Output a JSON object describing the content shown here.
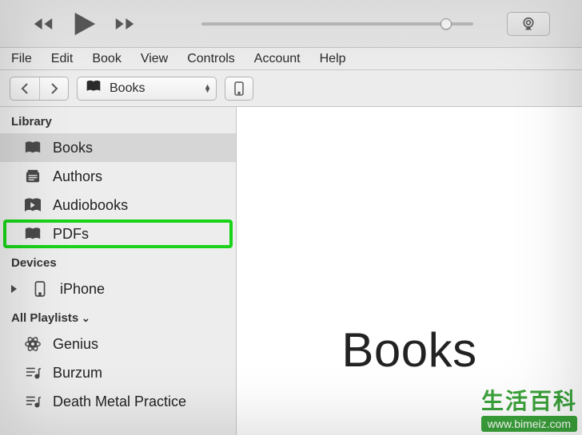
{
  "menu": {
    "items": [
      "File",
      "Edit",
      "Book",
      "View",
      "Controls",
      "Account",
      "Help"
    ]
  },
  "toolbar": {
    "media_selector": "Books"
  },
  "sidebar": {
    "library_label": "Library",
    "library_items": [
      {
        "id": "books",
        "label": "Books",
        "icon": "books-icon",
        "selected": true
      },
      {
        "id": "authors",
        "label": "Authors",
        "icon": "authors-icon"
      },
      {
        "id": "audiobooks",
        "label": "Audiobooks",
        "icon": "audiobook-icon"
      },
      {
        "id": "pdfs",
        "label": "PDFs",
        "icon": "books-icon",
        "highlight": true
      }
    ],
    "devices_label": "Devices",
    "devices": [
      {
        "id": "iphone",
        "label": "iPhone",
        "icon": "iphone-icon"
      }
    ],
    "playlists_label": "All Playlists",
    "playlists": [
      {
        "id": "genius",
        "label": "Genius",
        "icon": "genius-icon"
      },
      {
        "id": "burzum",
        "label": "Burzum",
        "icon": "playlist-icon"
      },
      {
        "id": "dmp",
        "label": "Death Metal Practice",
        "icon": "playlist-icon"
      }
    ]
  },
  "main": {
    "title": "Books"
  },
  "watermark": {
    "text": "生活百科",
    "url": "www.bimeiz.com"
  }
}
